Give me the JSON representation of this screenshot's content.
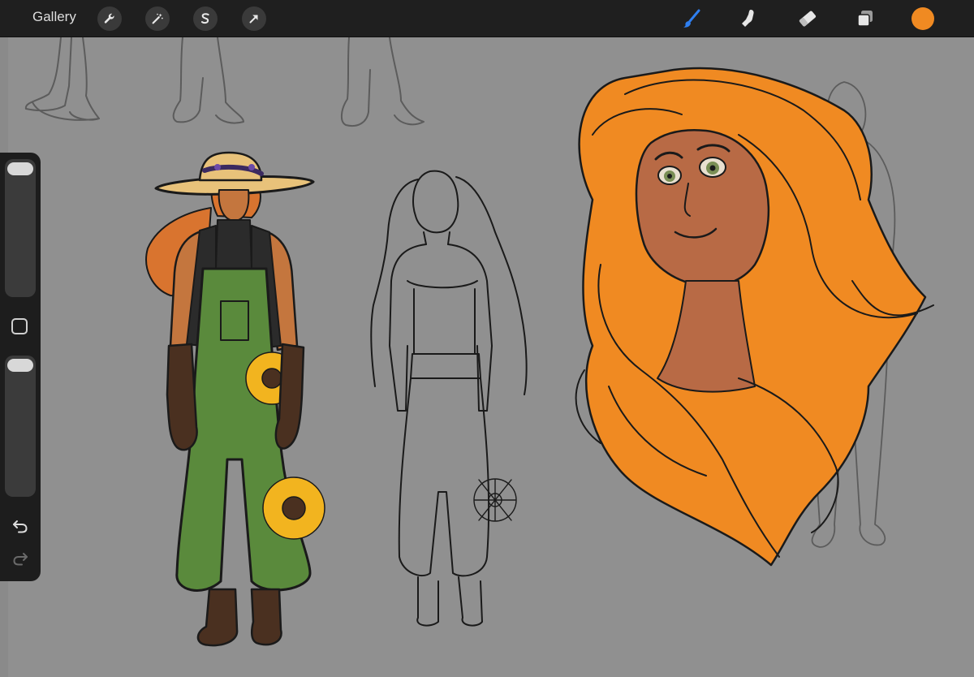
{
  "toolbar": {
    "gallery_label": "Gallery",
    "left_tools": [
      {
        "name": "actions",
        "icon": "wrench-icon"
      },
      {
        "name": "adjustments",
        "icon": "magic-wand-icon"
      },
      {
        "name": "selection",
        "icon": "selection-s-icon"
      },
      {
        "name": "transform",
        "icon": "arrow-cursor-icon"
      }
    ],
    "right_tools": [
      {
        "name": "brush",
        "icon": "brush-icon",
        "active": true
      },
      {
        "name": "smudge",
        "icon": "smudge-finger-icon",
        "active": false
      },
      {
        "name": "eraser",
        "icon": "eraser-icon",
        "active": false
      },
      {
        "name": "layers",
        "icon": "layers-icon",
        "active": false
      }
    ],
    "current_color": "#f08a22",
    "active_color": "#2f7ff0"
  },
  "sidebar": {
    "brush_size_level": 0.0,
    "opacity_level": 0.0,
    "modify_icon": "square-modify-icon",
    "undo_icon": "undo-arrow-icon",
    "redo_icon": "redo-arrow-icon"
  },
  "canvas": {
    "background": "#909090",
    "artwork": [
      {
        "name": "character-colored-overalls",
        "palette": [
          "#5a8a3c",
          "#2b2b2b",
          "#c4763e",
          "#e8c27a",
          "#f2b41f",
          "#4a3020"
        ]
      },
      {
        "name": "character-lineart-sketch",
        "palette": [
          "#1a1a1a"
        ]
      },
      {
        "name": "character-portrait-orange-hair",
        "palette": [
          "#f08a22",
          "#b86a45",
          "#1a1a1a"
        ]
      },
      {
        "name": "background-leg-sketches",
        "palette": [
          "#5c5c5c"
        ]
      }
    ]
  }
}
